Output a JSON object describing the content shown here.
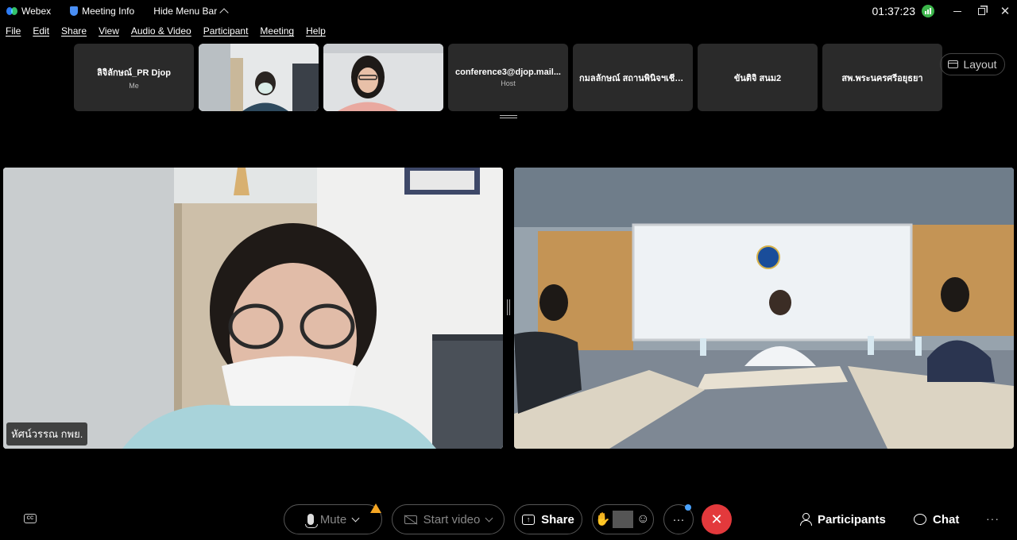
{
  "titlebar": {
    "app_name": "Webex",
    "meeting_info": "Meeting Info",
    "hide_menu": "Hide Menu Bar",
    "clock": "01:37:23"
  },
  "menu": [
    "File",
    "Edit",
    "Share",
    "View",
    "Audio & Video",
    "Participant",
    "Meeting",
    "Help"
  ],
  "participants": [
    {
      "name": "ลิจิลักษณ์_PR Djop",
      "role": "Me",
      "has_video": false
    },
    {
      "name": "",
      "role": "",
      "has_video": true
    },
    {
      "name": "",
      "role": "",
      "has_video": true
    },
    {
      "name": "conference3@djop.mail...",
      "role": "Host",
      "has_video": false
    },
    {
      "name": "กมลลักษณ์ สถานพินิจฯเชียง...",
      "role": "",
      "has_video": false
    },
    {
      "name": "ขันติจิ สนม2",
      "role": "",
      "has_video": false
    },
    {
      "name": "สพ.พระนครศรีอยุธยา",
      "role": "",
      "has_video": false
    }
  ],
  "layout_label": "Layout",
  "main_video": {
    "left_name": "หัศน์วรรณ กพย."
  },
  "controls": {
    "mute": "Mute",
    "start_video": "Start video",
    "share": "Share",
    "participants": "Participants",
    "chat": "Chat",
    "more": "···",
    "cc": "CC"
  },
  "colors": {
    "end_call": "#e3393c",
    "signal": "#3bb54a",
    "warning": "#f5a623",
    "notification": "#4aa3ff"
  }
}
